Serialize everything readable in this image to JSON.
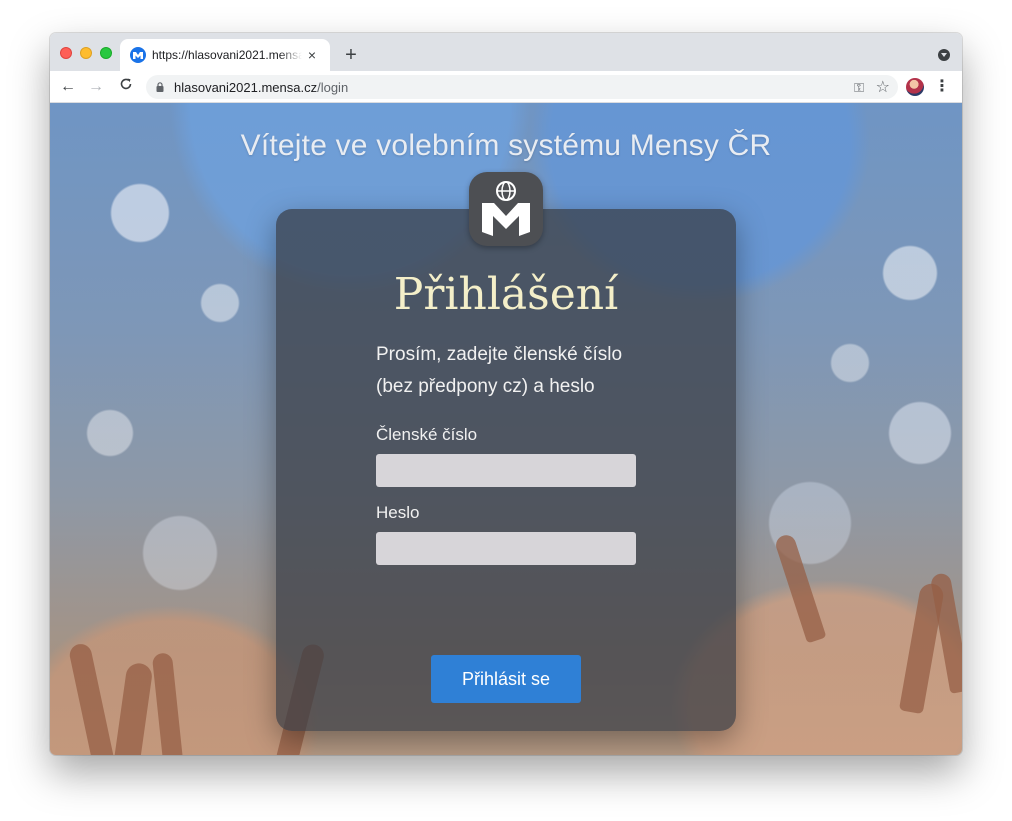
{
  "browser": {
    "tab": {
      "title": "https://hlasovani2021.mensa.cz/login",
      "close_icon": "×",
      "new_tab_icon": "+"
    },
    "toolbar": {
      "back_icon": "←",
      "forward_icon": "→",
      "reload_icon": "C",
      "url_host": "hlasovani2021.mensa.cz",
      "url_path": "/login",
      "key_icon": "⚿",
      "star_icon": "☆",
      "menu_icon": "⋮"
    }
  },
  "page": {
    "headline": "Vítejte ve volebním systému Mensy ČR",
    "login": {
      "title": "Přihlášení",
      "instructions_line1": "Prosím, zadejte členské číslo",
      "instructions_line2": "(bez předpony cz) a heslo",
      "member_label": "Členské číslo",
      "member_value": "",
      "password_label": "Heslo",
      "password_value": "",
      "submit_label": "Přihlásit se"
    }
  },
  "colors": {
    "accent": "#2f80d6",
    "title_color": "#f4efc9",
    "card_bg": "rgba(55,60,68,0.72)"
  }
}
